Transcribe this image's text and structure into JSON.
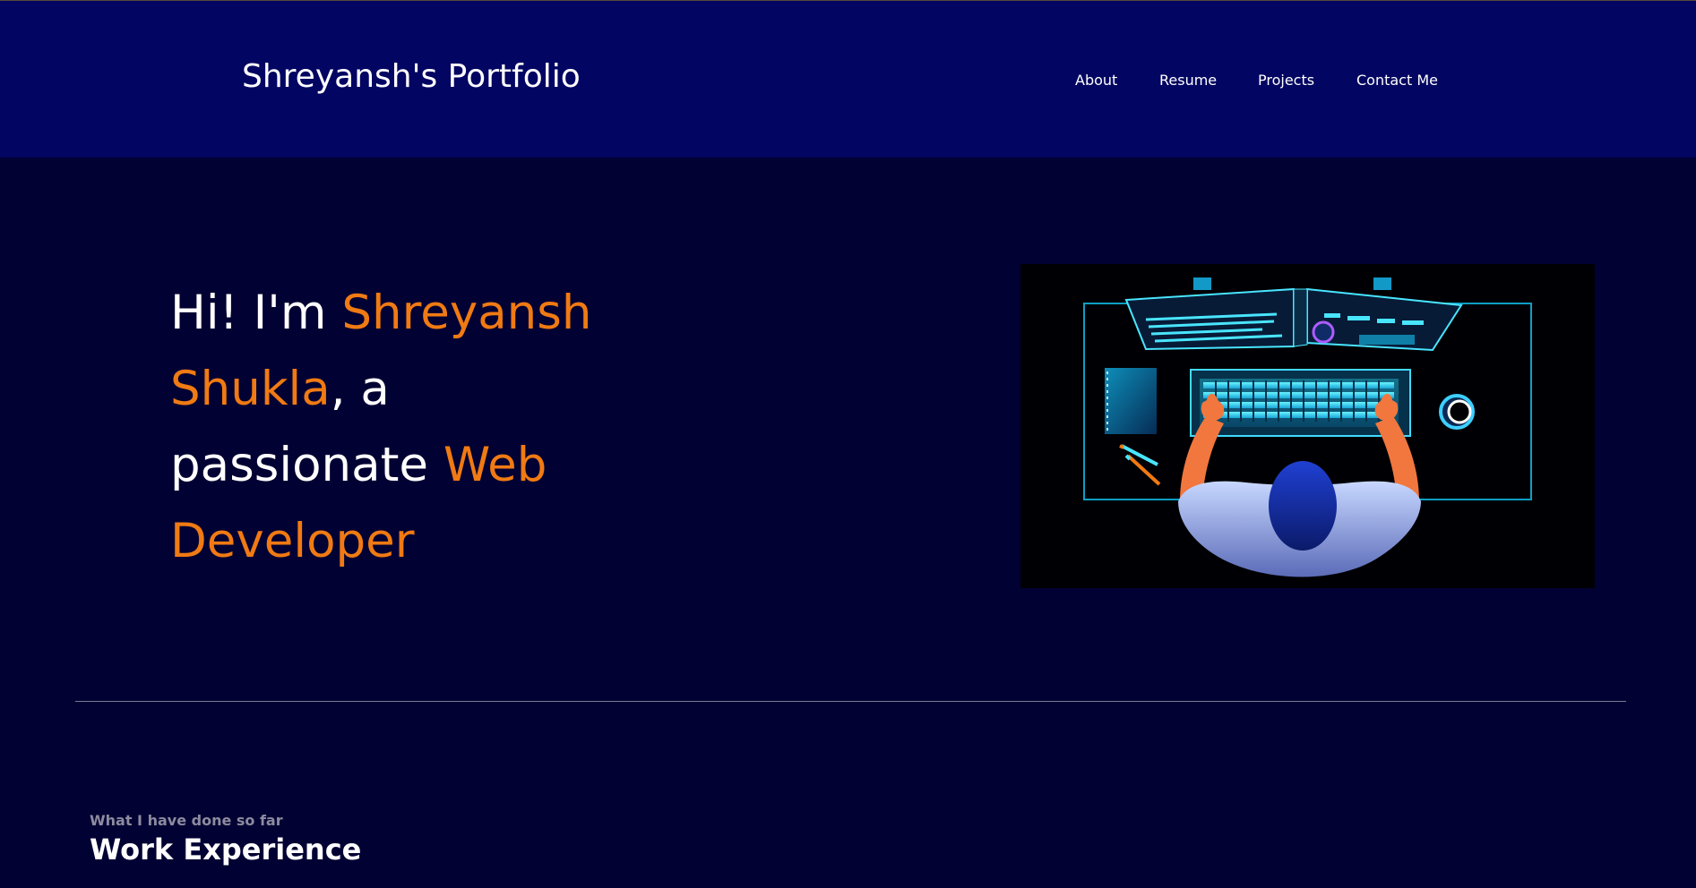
{
  "header": {
    "brand": "Shreyansh's Portfolio",
    "nav": {
      "about": "About",
      "resume": "Resume",
      "projects": "Projects",
      "contact": "Contact Me"
    }
  },
  "hero": {
    "greeting": "Hi! I'm ",
    "first_name": "Shreyansh",
    "last_name": "Shukla",
    "comma_a": ", a",
    "passionate": "passionate ",
    "web": "Web",
    "developer": "Developer",
    "image_icon": "developer-at-desk-illustration"
  },
  "experience": {
    "subtitle": "What I have done so far",
    "title": "Work Experience"
  },
  "colors": {
    "background": "#020133",
    "header": "#020561",
    "accent": "#f07a13",
    "text": "#ffffff"
  }
}
